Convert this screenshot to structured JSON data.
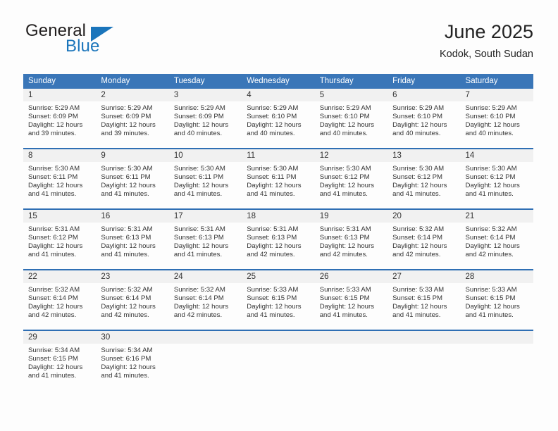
{
  "brand": {
    "name_part1": "General",
    "name_part2": "Blue",
    "triangle_icon": "triangle-icon"
  },
  "header": {
    "title": "June 2025",
    "location": "Kodok, South Sudan"
  },
  "colors": {
    "header_blue": "#3a76b8",
    "row_divider_blue": "#2f6fb4",
    "daynum_bg": "#f1f1f1",
    "brand_blue": "#1b75bb",
    "text": "#333333"
  },
  "weekday_headers": [
    "Sunday",
    "Monday",
    "Tuesday",
    "Wednesday",
    "Thursday",
    "Friday",
    "Saturday"
  ],
  "weeks": [
    [
      {
        "day": "1",
        "sunrise": "Sunrise: 5:29 AM",
        "sunset": "Sunset: 6:09 PM",
        "daylight_line1": "Daylight: 12 hours",
        "daylight_line2": "and 39 minutes."
      },
      {
        "day": "2",
        "sunrise": "Sunrise: 5:29 AM",
        "sunset": "Sunset: 6:09 PM",
        "daylight_line1": "Daylight: 12 hours",
        "daylight_line2": "and 39 minutes."
      },
      {
        "day": "3",
        "sunrise": "Sunrise: 5:29 AM",
        "sunset": "Sunset: 6:09 PM",
        "daylight_line1": "Daylight: 12 hours",
        "daylight_line2": "and 40 minutes."
      },
      {
        "day": "4",
        "sunrise": "Sunrise: 5:29 AM",
        "sunset": "Sunset: 6:10 PM",
        "daylight_line1": "Daylight: 12 hours",
        "daylight_line2": "and 40 minutes."
      },
      {
        "day": "5",
        "sunrise": "Sunrise: 5:29 AM",
        "sunset": "Sunset: 6:10 PM",
        "daylight_line1": "Daylight: 12 hours",
        "daylight_line2": "and 40 minutes."
      },
      {
        "day": "6",
        "sunrise": "Sunrise: 5:29 AM",
        "sunset": "Sunset: 6:10 PM",
        "daylight_line1": "Daylight: 12 hours",
        "daylight_line2": "and 40 minutes."
      },
      {
        "day": "7",
        "sunrise": "Sunrise: 5:29 AM",
        "sunset": "Sunset: 6:10 PM",
        "daylight_line1": "Daylight: 12 hours",
        "daylight_line2": "and 40 minutes."
      }
    ],
    [
      {
        "day": "8",
        "sunrise": "Sunrise: 5:30 AM",
        "sunset": "Sunset: 6:11 PM",
        "daylight_line1": "Daylight: 12 hours",
        "daylight_line2": "and 41 minutes."
      },
      {
        "day": "9",
        "sunrise": "Sunrise: 5:30 AM",
        "sunset": "Sunset: 6:11 PM",
        "daylight_line1": "Daylight: 12 hours",
        "daylight_line2": "and 41 minutes."
      },
      {
        "day": "10",
        "sunrise": "Sunrise: 5:30 AM",
        "sunset": "Sunset: 6:11 PM",
        "daylight_line1": "Daylight: 12 hours",
        "daylight_line2": "and 41 minutes."
      },
      {
        "day": "11",
        "sunrise": "Sunrise: 5:30 AM",
        "sunset": "Sunset: 6:11 PM",
        "daylight_line1": "Daylight: 12 hours",
        "daylight_line2": "and 41 minutes."
      },
      {
        "day": "12",
        "sunrise": "Sunrise: 5:30 AM",
        "sunset": "Sunset: 6:12 PM",
        "daylight_line1": "Daylight: 12 hours",
        "daylight_line2": "and 41 minutes."
      },
      {
        "day": "13",
        "sunrise": "Sunrise: 5:30 AM",
        "sunset": "Sunset: 6:12 PM",
        "daylight_line1": "Daylight: 12 hours",
        "daylight_line2": "and 41 minutes."
      },
      {
        "day": "14",
        "sunrise": "Sunrise: 5:30 AM",
        "sunset": "Sunset: 6:12 PM",
        "daylight_line1": "Daylight: 12 hours",
        "daylight_line2": "and 41 minutes."
      }
    ],
    [
      {
        "day": "15",
        "sunrise": "Sunrise: 5:31 AM",
        "sunset": "Sunset: 6:12 PM",
        "daylight_line1": "Daylight: 12 hours",
        "daylight_line2": "and 41 minutes."
      },
      {
        "day": "16",
        "sunrise": "Sunrise: 5:31 AM",
        "sunset": "Sunset: 6:13 PM",
        "daylight_line1": "Daylight: 12 hours",
        "daylight_line2": "and 41 minutes."
      },
      {
        "day": "17",
        "sunrise": "Sunrise: 5:31 AM",
        "sunset": "Sunset: 6:13 PM",
        "daylight_line1": "Daylight: 12 hours",
        "daylight_line2": "and 41 minutes."
      },
      {
        "day": "18",
        "sunrise": "Sunrise: 5:31 AM",
        "sunset": "Sunset: 6:13 PM",
        "daylight_line1": "Daylight: 12 hours",
        "daylight_line2": "and 42 minutes."
      },
      {
        "day": "19",
        "sunrise": "Sunrise: 5:31 AM",
        "sunset": "Sunset: 6:13 PM",
        "daylight_line1": "Daylight: 12 hours",
        "daylight_line2": "and 42 minutes."
      },
      {
        "day": "20",
        "sunrise": "Sunrise: 5:32 AM",
        "sunset": "Sunset: 6:14 PM",
        "daylight_line1": "Daylight: 12 hours",
        "daylight_line2": "and 42 minutes."
      },
      {
        "day": "21",
        "sunrise": "Sunrise: 5:32 AM",
        "sunset": "Sunset: 6:14 PM",
        "daylight_line1": "Daylight: 12 hours",
        "daylight_line2": "and 42 minutes."
      }
    ],
    [
      {
        "day": "22",
        "sunrise": "Sunrise: 5:32 AM",
        "sunset": "Sunset: 6:14 PM",
        "daylight_line1": "Daylight: 12 hours",
        "daylight_line2": "and 42 minutes."
      },
      {
        "day": "23",
        "sunrise": "Sunrise: 5:32 AM",
        "sunset": "Sunset: 6:14 PM",
        "daylight_line1": "Daylight: 12 hours",
        "daylight_line2": "and 42 minutes."
      },
      {
        "day": "24",
        "sunrise": "Sunrise: 5:32 AM",
        "sunset": "Sunset: 6:14 PM",
        "daylight_line1": "Daylight: 12 hours",
        "daylight_line2": "and 42 minutes."
      },
      {
        "day": "25",
        "sunrise": "Sunrise: 5:33 AM",
        "sunset": "Sunset: 6:15 PM",
        "daylight_line1": "Daylight: 12 hours",
        "daylight_line2": "and 41 minutes."
      },
      {
        "day": "26",
        "sunrise": "Sunrise: 5:33 AM",
        "sunset": "Sunset: 6:15 PM",
        "daylight_line1": "Daylight: 12 hours",
        "daylight_line2": "and 41 minutes."
      },
      {
        "day": "27",
        "sunrise": "Sunrise: 5:33 AM",
        "sunset": "Sunset: 6:15 PM",
        "daylight_line1": "Daylight: 12 hours",
        "daylight_line2": "and 41 minutes."
      },
      {
        "day": "28",
        "sunrise": "Sunrise: 5:33 AM",
        "sunset": "Sunset: 6:15 PM",
        "daylight_line1": "Daylight: 12 hours",
        "daylight_line2": "and 41 minutes."
      }
    ],
    [
      {
        "day": "29",
        "sunrise": "Sunrise: 5:34 AM",
        "sunset": "Sunset: 6:15 PM",
        "daylight_line1": "Daylight: 12 hours",
        "daylight_line2": "and 41 minutes."
      },
      {
        "day": "30",
        "sunrise": "Sunrise: 5:34 AM",
        "sunset": "Sunset: 6:16 PM",
        "daylight_line1": "Daylight: 12 hours",
        "daylight_line2": "and 41 minutes."
      },
      {
        "day": "",
        "sunrise": "",
        "sunset": "",
        "daylight_line1": "",
        "daylight_line2": ""
      },
      {
        "day": "",
        "sunrise": "",
        "sunset": "",
        "daylight_line1": "",
        "daylight_line2": ""
      },
      {
        "day": "",
        "sunrise": "",
        "sunset": "",
        "daylight_line1": "",
        "daylight_line2": ""
      },
      {
        "day": "",
        "sunrise": "",
        "sunset": "",
        "daylight_line1": "",
        "daylight_line2": ""
      },
      {
        "day": "",
        "sunrise": "",
        "sunset": "",
        "daylight_line1": "",
        "daylight_line2": ""
      }
    ]
  ]
}
